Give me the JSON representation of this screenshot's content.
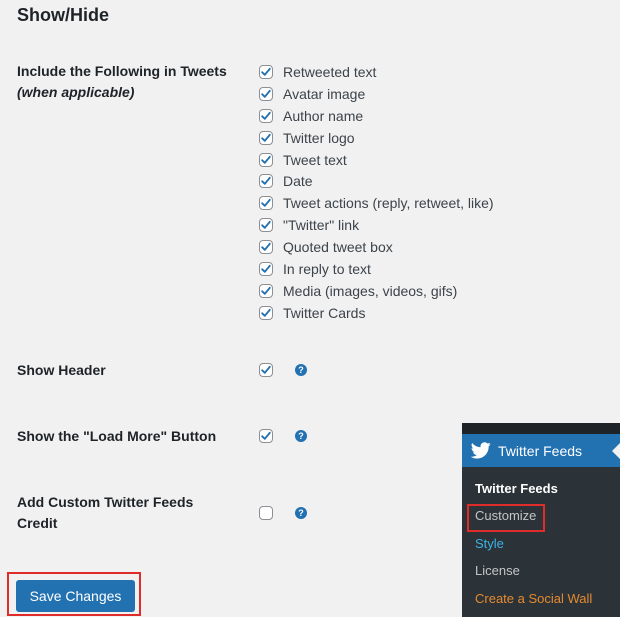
{
  "section": {
    "title": "Show/Hide"
  },
  "include_row": {
    "label_main": "Include the Following in Tweets ",
    "label_em": "(when applicable)",
    "options": [
      {
        "label": "Retweeted text",
        "checked": true
      },
      {
        "label": "Avatar image",
        "checked": true
      },
      {
        "label": "Author name",
        "checked": true
      },
      {
        "label": "Twitter logo",
        "checked": true
      },
      {
        "label": "Tweet text",
        "checked": true
      },
      {
        "label": "Date",
        "checked": true
      },
      {
        "label": "Tweet actions (reply, retweet, like)",
        "checked": true
      },
      {
        "label": "\"Twitter\" link",
        "checked": true
      },
      {
        "label": "Quoted tweet box",
        "checked": true
      },
      {
        "label": "In reply to text",
        "checked": true
      },
      {
        "label": "Media (images, videos, gifs)",
        "checked": true
      },
      {
        "label": "Twitter Cards",
        "checked": true
      }
    ]
  },
  "show_header": {
    "label": "Show Header",
    "checked": true,
    "help_icon": "?"
  },
  "load_more": {
    "label": "Show the \"Load More\" Button",
    "checked": true,
    "help_icon": "?"
  },
  "credit": {
    "label": "Add Custom Twitter Feeds Credit",
    "checked": false,
    "help_icon": "?"
  },
  "save_button": {
    "label": "Save Changes"
  },
  "admin_menu": {
    "head_label": "Twitter Feeds",
    "icon": "twitter-bird-icon",
    "items": [
      {
        "label": "Twitter Feeds",
        "state": "current"
      },
      {
        "label": "Customize",
        "state": "highlighted"
      },
      {
        "label": "Style",
        "state": "link"
      },
      {
        "label": "License",
        "state": "normal"
      },
      {
        "label": "Create a Social Wall",
        "state": "promo"
      }
    ]
  },
  "colors": {
    "accent": "#2271b1",
    "highlight_box": "#e02b2b",
    "menu_bg": "#2c3338",
    "style_link": "#3db2e7",
    "promo": "#e58a30"
  }
}
